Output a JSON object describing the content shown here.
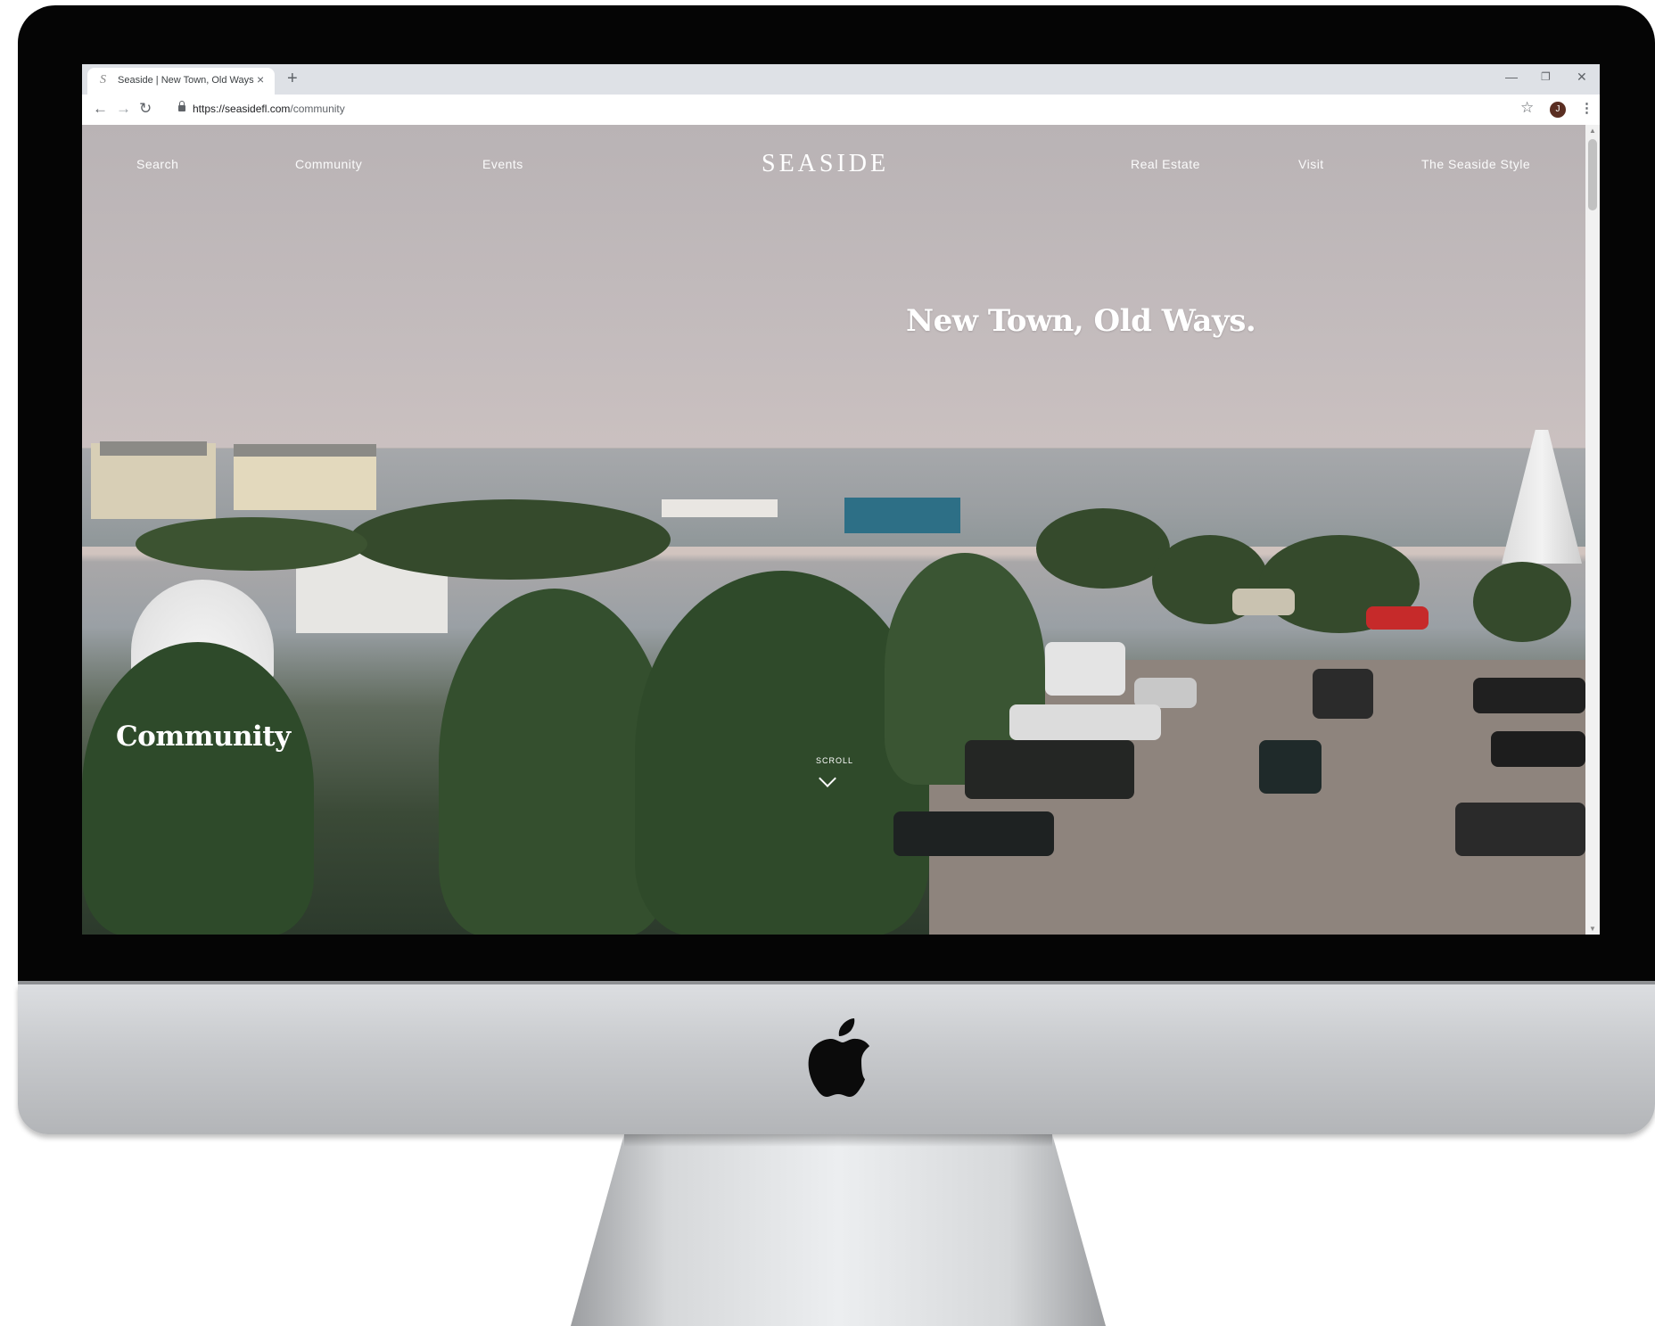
{
  "browser": {
    "tab_title": "Seaside | New Town, Old Ways",
    "tab_favicon": "S",
    "tab_close": "×",
    "new_tab": "+",
    "url_domain": "https://seasidefl.com",
    "url_path": "/community",
    "avatar_letter": "J"
  },
  "nav": {
    "search": "Search",
    "community": "Community",
    "events": "Events",
    "logo": "SEASIDE",
    "real_estate": "Real Estate",
    "visit": "Visit",
    "style": "The Seaside Style"
  },
  "hero": {
    "tagline": "New Town, Old Ways.",
    "heading": "Community",
    "scroll_label": "SCROLL"
  },
  "icons": {
    "back": "back-arrow-icon",
    "forward": "forward-arrow-icon",
    "reload": "reload-icon",
    "lock": "lock-icon",
    "star": "bookmark-star-icon",
    "menu": "kebab-menu-icon",
    "minimize": "minimize-icon",
    "restore": "restore-icon",
    "close": "close-icon",
    "apple": "apple-logo-icon"
  },
  "colors": {
    "bezel": "#050505",
    "chin": "#c7c9cc",
    "nav_text": "#ffffff"
  }
}
